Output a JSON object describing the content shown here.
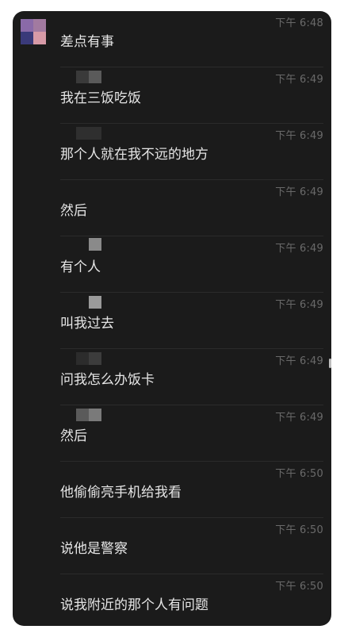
{
  "messages": [
    {
      "time": "下午 6:48",
      "text": "差点有事"
    },
    {
      "time": "下午 6:49",
      "text": "我在三饭吃饭"
    },
    {
      "time": "下午 6:49",
      "text": "那个人就在我不远的地方"
    },
    {
      "time": "下午 6:49",
      "text": "然后"
    },
    {
      "time": "下午 6:49",
      "text": "有个人"
    },
    {
      "time": "下午 6:49",
      "text": "叫我过去"
    },
    {
      "time": "下午 6:49",
      "text": "问我怎么办饭卡"
    },
    {
      "time": "下午 6:49",
      "text": "然后"
    },
    {
      "time": "下午 6:50",
      "text": "他偷偷亮手机给我看"
    },
    {
      "time": "下午 6:50",
      "text": "说他是警察"
    },
    {
      "time": "下午 6:50",
      "text": "说我附近的那个人有问题"
    }
  ],
  "colors": {
    "panel_bg": "#1b1b1b",
    "text": "#e6e6e6",
    "time": "#6a6a6a",
    "divider": "#2b2b2b"
  },
  "icons": {
    "sender_avatar": "pixelated-avatar"
  }
}
